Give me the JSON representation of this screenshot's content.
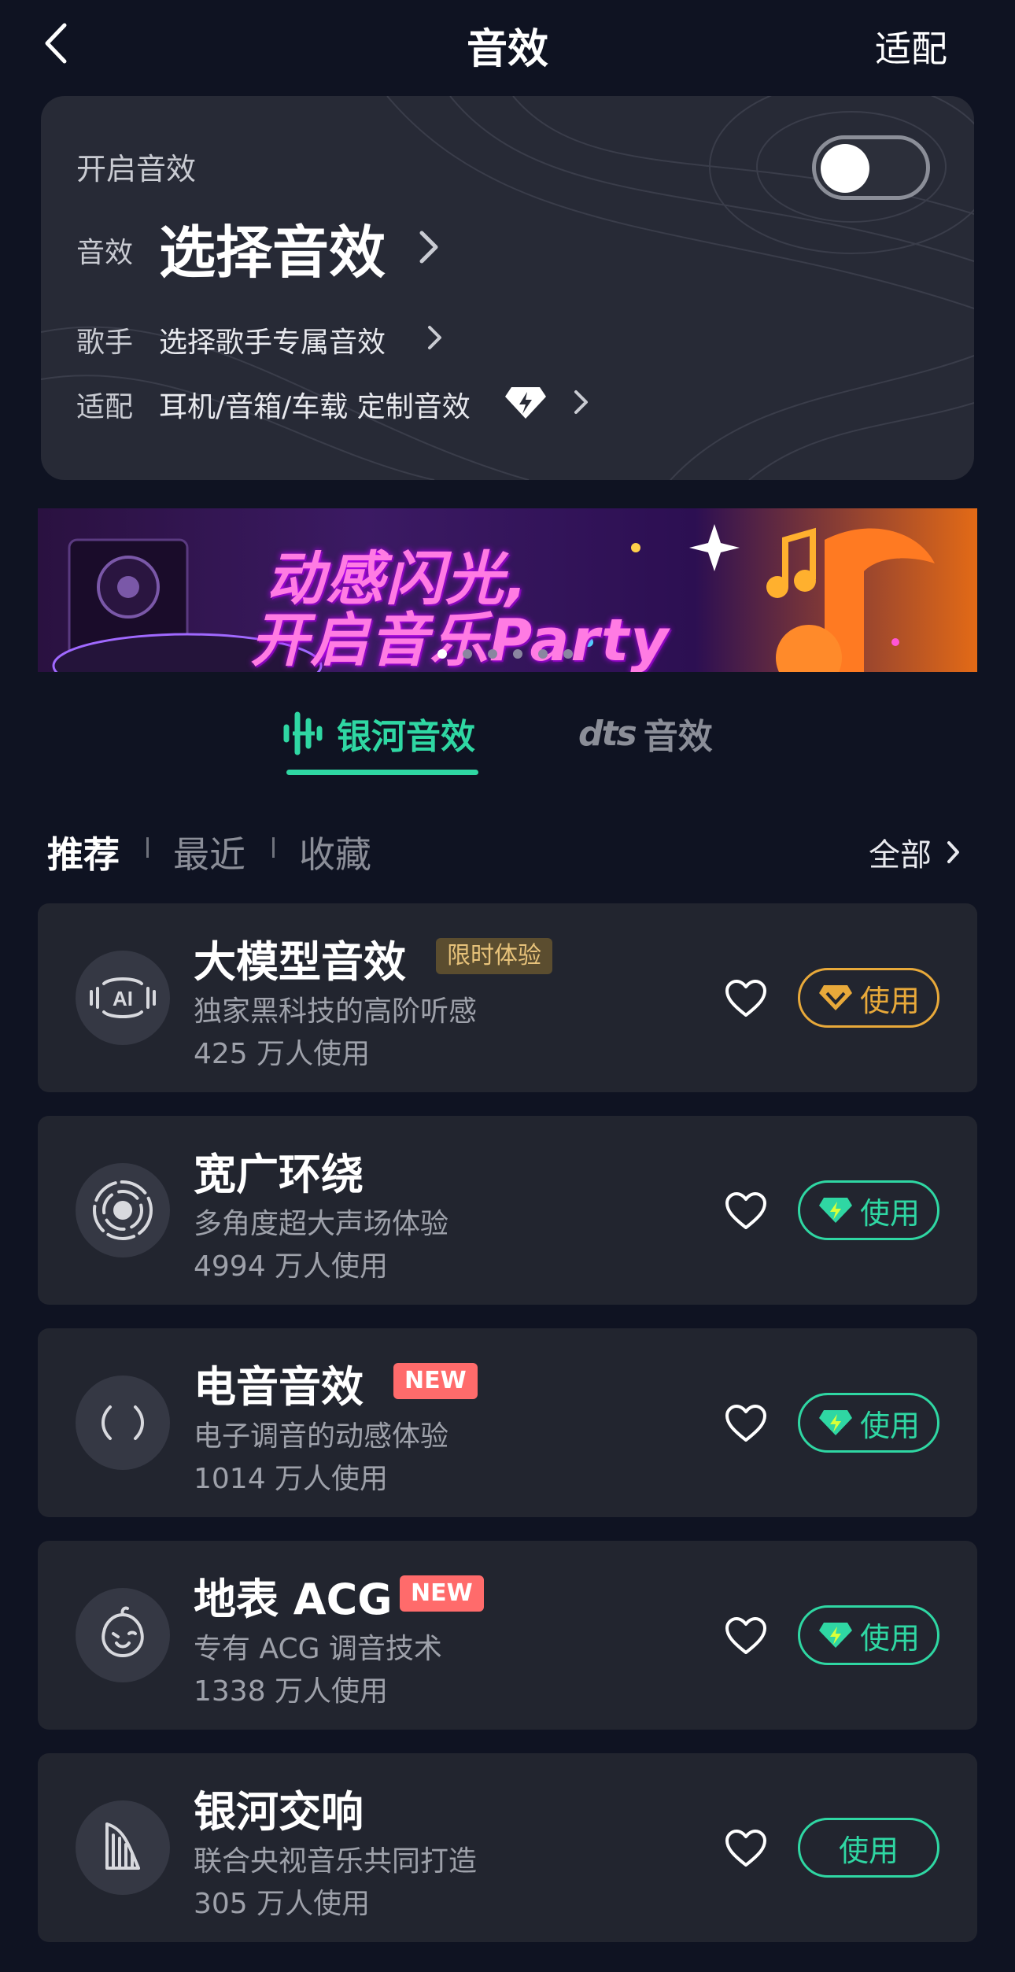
{
  "header": {
    "title": "音效",
    "right_action": "适配"
  },
  "top_card": {
    "open_label": "开启音效",
    "toggle_on": false,
    "effect_label": "音效",
    "effect_value": "选择音效",
    "singer_label": "歌手",
    "singer_value": "选择歌手专属音效",
    "adapt_label": "适配",
    "adapt_value": "耳机/音箱/车载 定制音效"
  },
  "banner": {
    "line1": "动感闪光,",
    "line2": "开启音乐Party",
    "dot_count": 6,
    "active_dot": 0
  },
  "brand_tabs": [
    {
      "label": "银河音效",
      "active": true
    },
    {
      "label": "音效",
      "brand": "dts",
      "active": false
    }
  ],
  "sub_tabs": {
    "items": [
      "推荐",
      "最近",
      "收藏"
    ],
    "active": 0,
    "all_label": "全部"
  },
  "effects": [
    {
      "name": "大模型音效",
      "badge": "限时体验",
      "desc": "独家黑科技的高阶听感",
      "count": "425 万人使用",
      "button": "使用",
      "icon": "ai-icon",
      "style": "gold"
    },
    {
      "name": "宽广环绕",
      "badge": "",
      "desc": "多角度超大声场体验",
      "count": "4994 万人使用",
      "button": "使用",
      "icon": "surround-icon",
      "style": "green-vip"
    },
    {
      "name": "电音音效",
      "badge": "NEW",
      "desc": "电子调音的动感体验",
      "count": "1014 万人使用",
      "button": "使用",
      "icon": "electronic-icon",
      "style": "green-vip"
    },
    {
      "name": "地表 ACG",
      "badge": "NEW",
      "desc": "专有 ACG 调音技术",
      "count": "1338 万人使用",
      "button": "使用",
      "icon": "acg-face-icon",
      "style": "green-vip"
    },
    {
      "name": "银河交响",
      "badge": "",
      "desc": "联合央视音乐共同打造",
      "count": "305 万人使用",
      "button": "使用",
      "icon": "harp-icon",
      "style": "green"
    }
  ],
  "colors": {
    "accent": "#2fd7a3",
    "gold": "#e8a93a",
    "background": "#0f1322",
    "card": "#22252f"
  }
}
